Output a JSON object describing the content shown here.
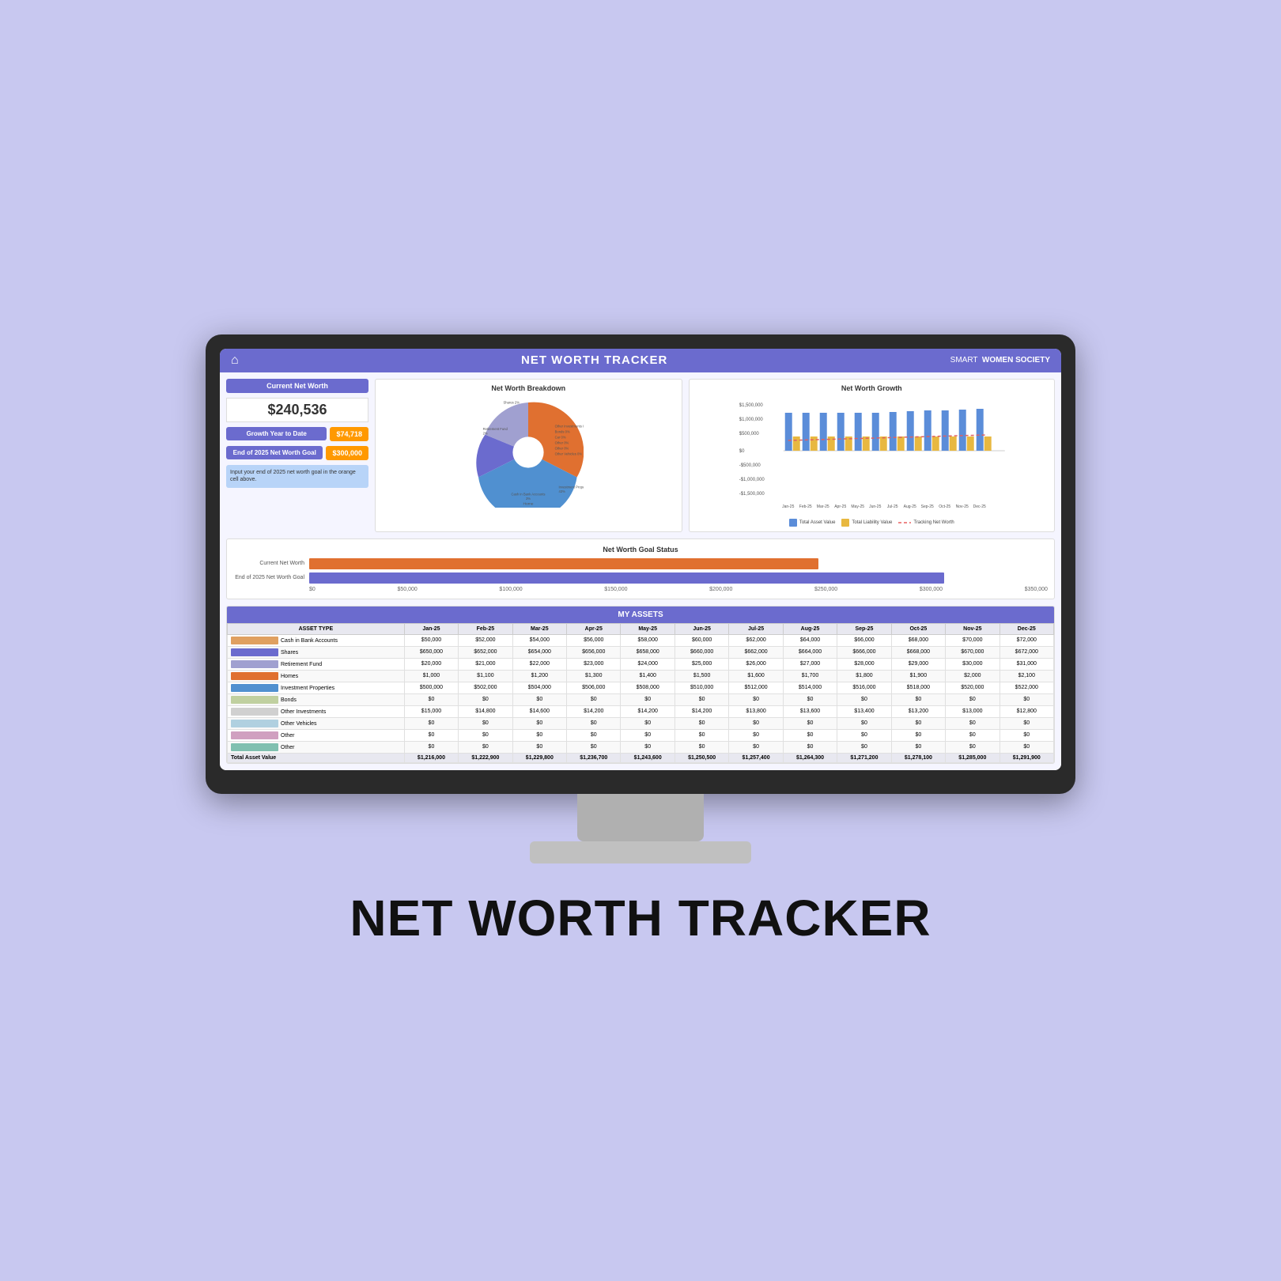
{
  "page": {
    "background_color": "#c8c8f0",
    "bottom_title": "NET WORTH TRACKER"
  },
  "header": {
    "title": "NET WORTH TRACKER",
    "brand_prefix": "SMART",
    "brand_suffix": "WOMEN SOCIETY"
  },
  "metrics": {
    "net_worth_label": "Current Net Worth",
    "net_worth_value": "$240,536",
    "growth_label": "Growth Year to Date",
    "growth_value": "$74,718",
    "goal_label": "End of 2025 Net Worth Goal",
    "goal_value": "$300,000",
    "info_text": "Input your end of 2025 net worth goal in the orange cell above."
  },
  "pie_chart": {
    "title": "Net Worth Breakdown",
    "segments": [
      {
        "label": "Home",
        "pct": 33,
        "color": "#e07030"
      },
      {
        "label": "Shares",
        "pct": 2,
        "color": "#6b6bce"
      },
      {
        "label": "Retirement Fund",
        "pct": 2,
        "color": "#a0a0d0"
      },
      {
        "label": "Investment Properties",
        "pct": 43,
        "color": "#5090d0"
      },
      {
        "label": "Bonds",
        "pct": 0,
        "color": "#c0d0a0"
      },
      {
        "label": "Car",
        "pct": 0,
        "color": "#e0c080"
      },
      {
        "label": "Other",
        "pct": 0,
        "color": "#d0a0c0"
      },
      {
        "label": "Other 0%",
        "pct": 0,
        "color": "#80c0b0"
      },
      {
        "label": "Other Vehicles",
        "pct": 0,
        "color": "#b0d0e0"
      },
      {
        "label": "Other Investments",
        "pct": 0,
        "color": "#d0d0d0"
      },
      {
        "label": "Cash in Bank Accounts",
        "pct": 3,
        "color": "#e0a060"
      },
      {
        "label": "Other",
        "pct": 0,
        "color": "#c0c0e0"
      }
    ]
  },
  "bar_chart": {
    "title": "Net Worth Growth",
    "y_labels": [
      "$1,500,000",
      "$1,000,000",
      "$500,000",
      "$0",
      "-$500,000",
      "-$1,000,000",
      "-$1,500,000"
    ],
    "months": [
      "Jan-25",
      "Feb-25",
      "Mar-25",
      "Apr-25",
      "May-25",
      "Jun-25",
      "Jul-25",
      "Aug-25",
      "Sep-25",
      "Oct-25",
      "Nov-25",
      "Dec-25"
    ],
    "legend": [
      {
        "label": "Total Asset Value",
        "color": "#5b8dd9"
      },
      {
        "label": "Total Liability Value",
        "color": "#e8b840"
      },
      {
        "label": "Tracking Net Worth",
        "color": "#e06060",
        "type": "dashed"
      }
    ]
  },
  "goal_status": {
    "title": "Net Worth Goal Status",
    "current_label": "Current Net Worth",
    "goal_label": "End of 2025 Net Worth Goal",
    "current_pct": 69,
    "goal_pct": 86,
    "current_color": "#e07030",
    "goal_color": "#6b6bce",
    "axis_labels": [
      "$0",
      "$50,000",
      "$100,000",
      "$150,000",
      "$200,000",
      "$250,000",
      "$300,000",
      "$350,000"
    ]
  },
  "assets_table": {
    "section_title": "MY ASSETS",
    "columns": [
      "ASSET TYPE",
      "Jan-25",
      "Feb-25",
      "Mar-25",
      "Apr-25",
      "May-25",
      "Jun-25",
      "Jul-25",
      "Aug-25",
      "Sep-25",
      "Oct-25",
      "Nov-25",
      "Dec-25"
    ],
    "rows": [
      {
        "label": "Cash in Bank Accounts",
        "color": "#e0a060",
        "values": [
          "$50,000",
          "$52,000",
          "$54,000",
          "$56,000",
          "$58,000",
          "$60,000",
          "$62,000",
          "$64,000",
          "$66,000",
          "$68,000",
          "$70,000",
          "$72,000"
        ]
      },
      {
        "label": "Shares",
        "color": "#6b6bce",
        "values": [
          "$650,000",
          "$652,000",
          "$654,000",
          "$656,000",
          "$658,000",
          "$660,000",
          "$662,000",
          "$664,000",
          "$666,000",
          "$668,000",
          "$670,000",
          "$672,000"
        ]
      },
      {
        "label": "Retirement Fund",
        "color": "#a0a0d0",
        "values": [
          "$20,000",
          "$21,000",
          "$22,000",
          "$23,000",
          "$24,000",
          "$25,000",
          "$26,000",
          "$27,000",
          "$28,000",
          "$29,000",
          "$30,000",
          "$31,000"
        ]
      },
      {
        "label": "Homes",
        "color": "#e07030",
        "values": [
          "$1,000",
          "$1,100",
          "$1,200",
          "$1,300",
          "$1,400",
          "$1,500",
          "$1,600",
          "$1,700",
          "$1,800",
          "$1,900",
          "$2,000",
          "$2,100"
        ]
      },
      {
        "label": "Investment Properties",
        "color": "#5090d0",
        "values": [
          "$500,000",
          "$502,000",
          "$504,000",
          "$506,000",
          "$508,000",
          "$510,000",
          "$512,000",
          "$514,000",
          "$516,000",
          "$518,000",
          "$520,000",
          "$522,000"
        ]
      },
      {
        "label": "Bonds",
        "color": "#c0d0a0",
        "values": [
          "$0",
          "$0",
          "$0",
          "$0",
          "$0",
          "$0",
          "$0",
          "$0",
          "$0",
          "$0",
          "$0",
          "$0"
        ]
      },
      {
        "label": "Other Investments",
        "color": "#d0d0d0",
        "values": [
          "$15,000",
          "$14,800",
          "$14,600",
          "$14,200",
          "$14,200",
          "$14,200",
          "$13,800",
          "$13,600",
          "$13,400",
          "$13,200",
          "$13,000",
          "$12,800"
        ]
      },
      {
        "label": "Other Vehicles",
        "color": "#b0d0e0",
        "values": [
          "$0",
          "$0",
          "$0",
          "$0",
          "$0",
          "$0",
          "$0",
          "$0",
          "$0",
          "$0",
          "$0",
          "$0"
        ]
      },
      {
        "label": "Other",
        "color": "#d0a0c0",
        "values": [
          "$0",
          "$0",
          "$0",
          "$0",
          "$0",
          "$0",
          "$0",
          "$0",
          "$0",
          "$0",
          "$0",
          "$0"
        ]
      },
      {
        "label": "Other",
        "color": "#80c0b0",
        "values": [
          "$0",
          "$0",
          "$0",
          "$0",
          "$0",
          "$0",
          "$0",
          "$0",
          "$0",
          "$0",
          "$0",
          "$0"
        ]
      }
    ],
    "total_row": {
      "label": "Total Asset Value",
      "values": [
        "$1,216,000",
        "$1,222,900",
        "$1,229,800",
        "$1,236,700",
        "$1,243,600",
        "$1,250,500",
        "$1,257,400",
        "$1,264,300",
        "$1,271,200",
        "$1,278,100",
        "$1,285,000",
        "$1,291,900"
      ]
    }
  }
}
